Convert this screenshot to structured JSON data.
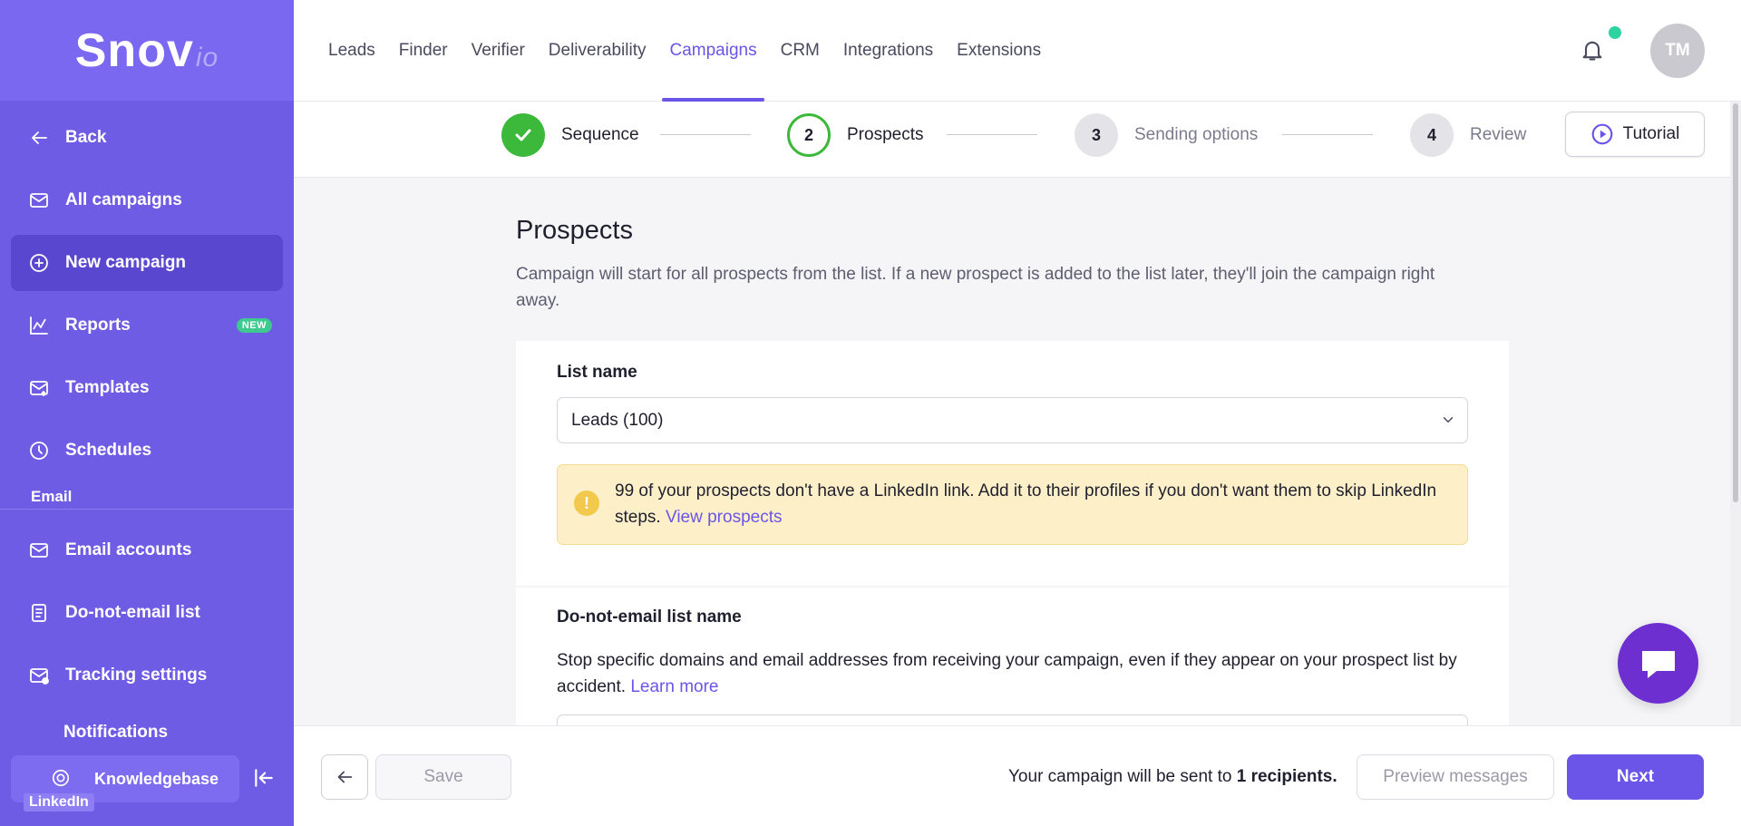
{
  "brand": {
    "logo_main": "Snov",
    "logo_suffix": "io"
  },
  "sidebar": {
    "items": [
      {
        "label": "Back",
        "icon": "arrow-left-icon"
      },
      {
        "label": "All campaigns",
        "icon": "envelope-icon"
      },
      {
        "label": "New campaign",
        "icon": "plus-circle-icon",
        "active": true
      },
      {
        "label": "Reports",
        "icon": "chart-icon",
        "badge": "NEW"
      },
      {
        "label": "Templates",
        "icon": "template-icon"
      },
      {
        "label": "Schedules",
        "icon": "clock-icon"
      }
    ],
    "section_email": "Email",
    "email_items": [
      {
        "label": "Email accounts",
        "icon": "envelope-icon"
      },
      {
        "label": "Do-not-email list",
        "icon": "document-icon"
      },
      {
        "label": "Tracking settings",
        "icon": "envelope-dot-icon"
      }
    ],
    "partial_item": "Notifications",
    "knowledgebase": "Knowledgebase",
    "linkedin_tag": "LinkedIn"
  },
  "topnav": {
    "items": [
      "Leads",
      "Finder",
      "Verifier",
      "Deliverability",
      "Campaigns",
      "CRM",
      "Integrations",
      "Extensions"
    ],
    "active": "Campaigns",
    "avatar_initials": "TM"
  },
  "stepper": {
    "steps": [
      {
        "number": "",
        "label": "Sequence",
        "state": "done"
      },
      {
        "number": "2",
        "label": "Prospects",
        "state": "current"
      },
      {
        "number": "3",
        "label": "Sending options",
        "state": "future"
      },
      {
        "number": "4",
        "label": "Review",
        "state": "future"
      }
    ],
    "tutorial_label": "Tutorial"
  },
  "main": {
    "title": "Prospects",
    "description": "Campaign will start for all prospects from the list. If a new prospect is added to the list later, they'll join the campaign right away.",
    "list_name_label": "List name",
    "list_name_value": "Leads (100)",
    "warning_text": "99 of your prospects don't have a LinkedIn link. Add it to their profiles if you don't want them to skip LinkedIn steps.",
    "warning_link": "View prospects",
    "dne_label": "Do-not-email list name",
    "dne_desc": "Stop specific domains and email addresses from receiving your campaign, even if they appear on your prospect list by accident.",
    "dne_link": "Learn more"
  },
  "footer": {
    "save_label": "Save",
    "send_text_prefix": "Your campaign will be sent to",
    "send_text_count": "1 recipients.",
    "preview_label": "Preview messages",
    "next_label": "Next"
  },
  "colors": {
    "sidebar_bg": "#6f5ce4",
    "accent": "#6b55e8",
    "success": "#3cb83a",
    "chat": "#6d2fd0"
  }
}
